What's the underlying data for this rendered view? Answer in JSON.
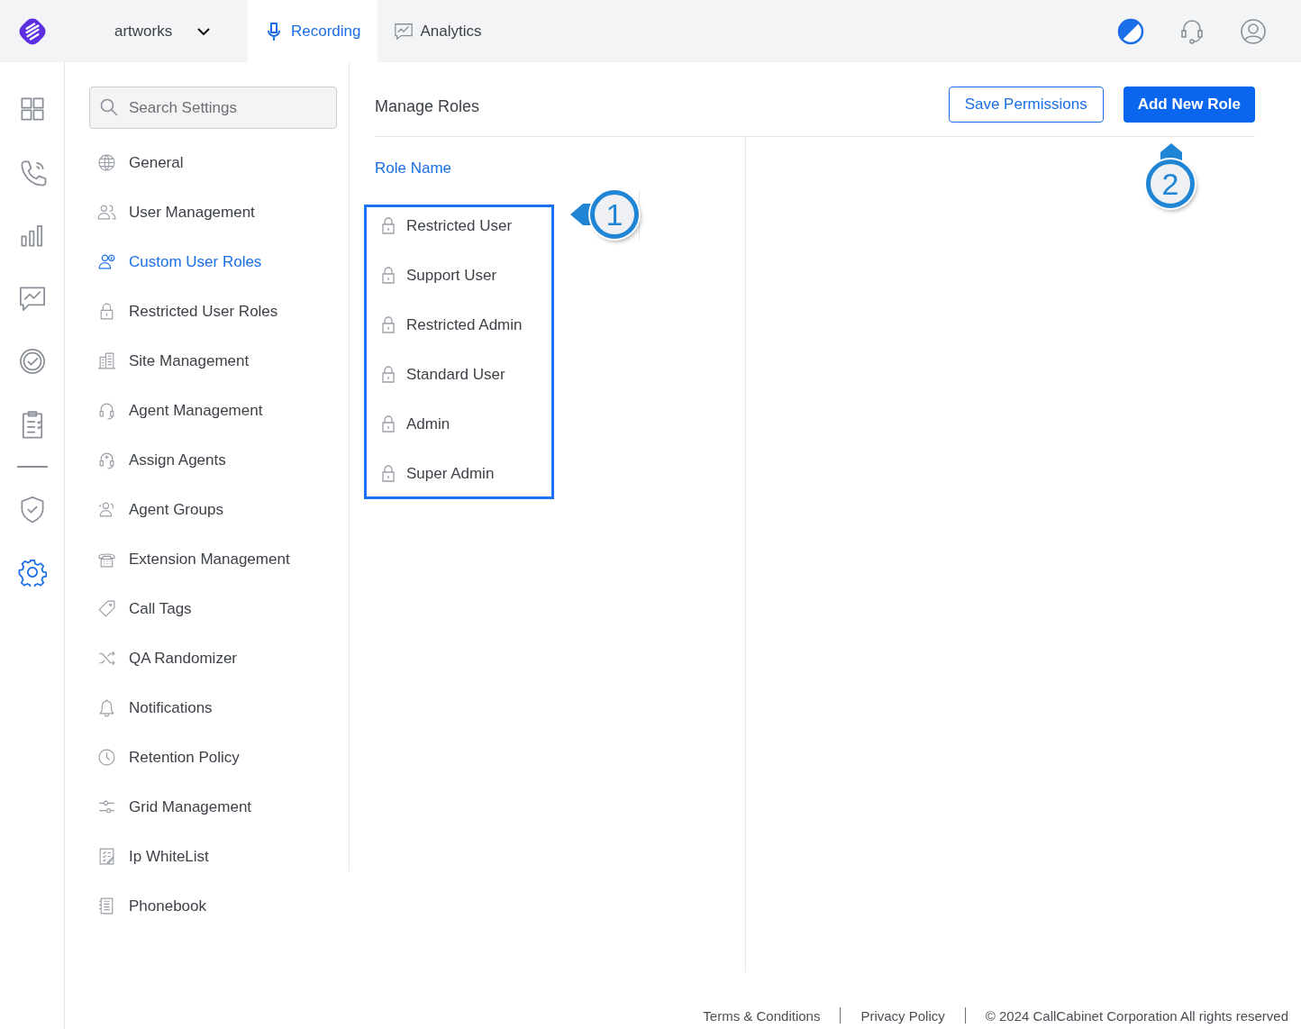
{
  "topbar": {
    "workspace": "artworks",
    "tabs": [
      {
        "label": "Recording",
        "selected": true
      },
      {
        "label": "Analytics",
        "selected": false
      }
    ]
  },
  "rail": [
    {
      "selected": false
    },
    {
      "selected": false
    },
    {
      "selected": false
    },
    {
      "selected": false
    },
    {
      "selected": false
    },
    {
      "selected": false
    },
    {
      "selected": false
    },
    {
      "selected": true
    }
  ],
  "settings": {
    "search": {
      "placeholder": "Search Settings"
    },
    "items": [
      {
        "label": "General",
        "selected": false
      },
      {
        "label": "User Management",
        "selected": false
      },
      {
        "label": "Custom User Roles",
        "selected": true
      },
      {
        "label": "Restricted User Roles",
        "selected": false
      },
      {
        "label": "Site Management",
        "selected": false
      },
      {
        "label": "Agent Management",
        "selected": false
      },
      {
        "label": "Assign Agents",
        "selected": false
      },
      {
        "label": "Agent Groups",
        "selected": false
      },
      {
        "label": "Extension Management",
        "selected": false
      },
      {
        "label": "Call Tags",
        "selected": false
      },
      {
        "label": "QA Randomizer",
        "selected": false
      },
      {
        "label": "Notifications",
        "selected": false
      },
      {
        "label": "Retention Policy",
        "selected": false
      },
      {
        "label": "Grid Management",
        "selected": false
      },
      {
        "label": "Ip WhiteList",
        "selected": false
      },
      {
        "label": "Phonebook",
        "selected": false
      }
    ]
  },
  "main": {
    "title": "Manage Roles",
    "buttons": [
      {
        "label": "Save Permissions",
        "kind": "outline"
      },
      {
        "label": "Add New Role",
        "kind": "primary"
      }
    ],
    "column": "Role Name",
    "roles": [
      "Restricted User",
      "Support User",
      "Restricted Admin",
      "Standard User",
      "Admin",
      "Super Admin"
    ],
    "callouts": [
      {
        "label": "1",
        "kind": "left"
      },
      {
        "label": "2",
        "kind": "up"
      }
    ]
  },
  "footer": {
    "links": [
      "Terms & Conditions",
      "Privacy Policy"
    ],
    "copyright": "© 2024 CallCabinet Corporation All rights reserved"
  }
}
